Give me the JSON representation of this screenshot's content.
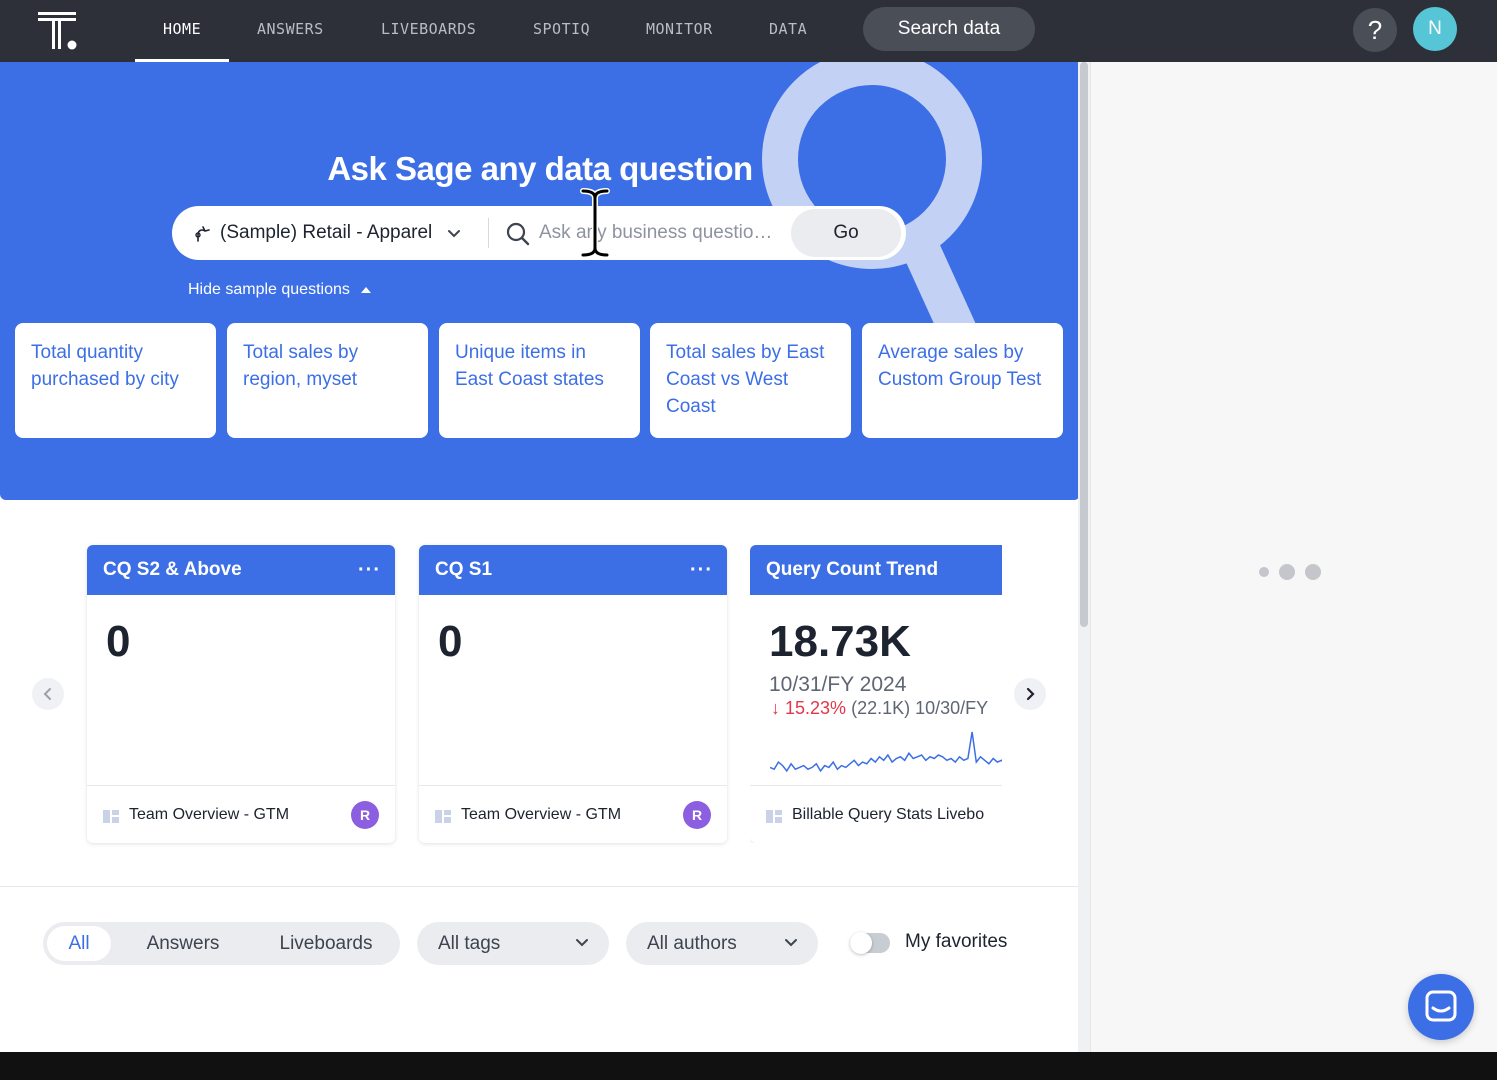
{
  "nav": {
    "items": [
      {
        "label": "HOME",
        "active": true
      },
      {
        "label": "ANSWERS",
        "active": false
      },
      {
        "label": "LIVEBOARDS",
        "active": false
      },
      {
        "label": "SPOTIQ",
        "active": false
      },
      {
        "label": "MONITOR",
        "active": false
      },
      {
        "label": "DATA",
        "active": false
      }
    ],
    "search_data_label": "Search data",
    "help_label": "?",
    "avatar_initial": "N"
  },
  "hero": {
    "title": "Ask Sage any data question",
    "source_label": "(Sample) Retail - Apparel",
    "question_placeholder": "Ask any business questio…",
    "go_label": "Go",
    "hide_label": "Hide sample questions",
    "sample_questions": [
      "Total quantity purchased by city",
      "Total sales by region, myset",
      "Unique items in East Coast states",
      "Total sales by East Coast vs West Coast",
      "Average sales by Custom Group Test"
    ]
  },
  "kpi_cards": [
    {
      "title": "CQ S2 & Above",
      "value": "0",
      "liveboard": "Team Overview - GTM",
      "author_initial": "R"
    },
    {
      "title": "CQ S1",
      "value": "0",
      "liveboard": "Team Overview - GTM",
      "author_initial": "R"
    }
  ],
  "trend_card": {
    "title": "Query Count Trend",
    "value": "18.73K",
    "date": "10/31/FY 2024",
    "change_pct": "15.23%",
    "change_rest": "(22.1K) 10/30/FY",
    "liveboard": "Billable Query Stats Livebo",
    "sparkline": [
      6,
      5,
      9,
      7,
      4,
      8,
      5,
      6,
      7,
      5,
      6,
      8,
      4,
      7,
      6,
      9,
      5,
      7,
      6,
      8,
      10,
      7,
      9,
      8,
      11,
      9,
      12,
      10,
      13,
      9,
      11,
      12,
      10,
      14,
      11,
      12,
      13,
      10,
      12,
      11,
      13,
      12,
      10,
      11,
      9,
      12,
      10,
      11,
      26,
      9,
      12,
      10,
      8,
      11,
      9,
      10,
      8,
      9
    ]
  },
  "filters": {
    "segments": [
      {
        "label": "All",
        "active": true
      },
      {
        "label": "Answers",
        "active": false
      },
      {
        "label": "Liveboards",
        "active": false
      }
    ],
    "tags_label": "All tags",
    "authors_label": "All authors",
    "favorites_label": "My favorites"
  },
  "colors": {
    "nav_bg": "#2d3038",
    "accent": "#3c6fe6",
    "negative": "#e2364a",
    "avatar": "#56c6d6",
    "author_badge": "#8b5fe0"
  }
}
